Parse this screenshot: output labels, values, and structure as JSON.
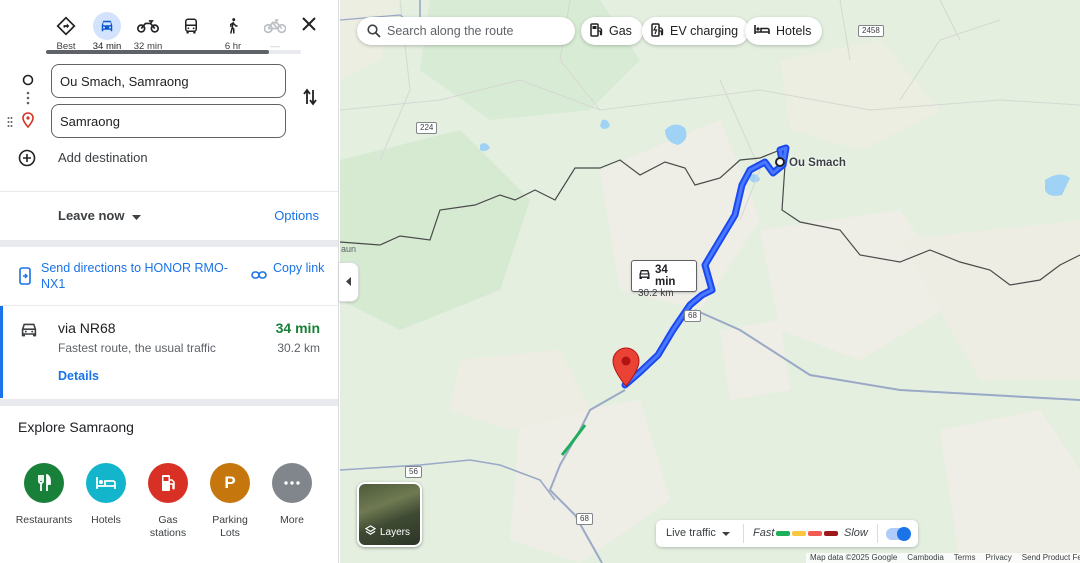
{
  "modes": [
    {
      "id": "best",
      "label": "Best",
      "icon": "diamond-directions-icon"
    },
    {
      "id": "drive",
      "label": "34 min",
      "icon": "car-icon",
      "active": true
    },
    {
      "id": "motorbike",
      "label": "32 min",
      "icon": "motorbike-icon"
    },
    {
      "id": "transit",
      "label": "",
      "icon": "bus-icon"
    },
    {
      "id": "walk",
      "label": "6 hr",
      "icon": "walk-icon"
    },
    {
      "id": "bike",
      "label": "—",
      "icon": "bicycle-icon",
      "disabled": true
    }
  ],
  "origin": "Ou Smach, Samraong",
  "destination": "Samraong",
  "add_destination": "Add destination",
  "leave_now": "Leave now",
  "options": "Options",
  "send_directions": "Send directions to HONOR RMO-NX1",
  "copy_link": "Copy link",
  "route": {
    "via": "via NR68",
    "subtitle": "Fastest route, the usual traffic",
    "time": "34 min",
    "distance": "30.2 km",
    "details": "Details"
  },
  "explore": {
    "title": "Explore Samraong",
    "items": [
      {
        "label": "Restaurants",
        "icon": "fork-knife-icon",
        "color": "#188038"
      },
      {
        "label": "Hotels",
        "icon": "bed-icon",
        "color": "#12b5cb"
      },
      {
        "label": "Gas stations",
        "icon": "gas-pump-icon",
        "color": "#d93025"
      },
      {
        "label": "Parking Lots",
        "icon": "parking-icon",
        "color": "#c5760c"
      },
      {
        "label": "More",
        "icon": "more-dots-icon",
        "color": "#80868b"
      }
    ]
  },
  "map": {
    "search_placeholder": "Search along the route",
    "chips": [
      "Gas",
      "EV charging",
      "Hotels"
    ],
    "route_label_time": "34 min",
    "route_label_distance": "30.2 km",
    "place_label": "Ou Smach",
    "partial_label": "aun",
    "road_numbers": [
      "2458",
      "224",
      "68",
      "56",
      "68"
    ],
    "layers_label": "Layers",
    "traffic": {
      "live": "Live traffic",
      "fast": "Fast",
      "slow": "Slow"
    },
    "attribution": [
      "Map data ©2025 Google",
      "Cambodia",
      "Terms",
      "Privacy",
      "Send Product Feedback"
    ],
    "route_color": "#1a49f0",
    "pin_color": "#ea4335"
  }
}
